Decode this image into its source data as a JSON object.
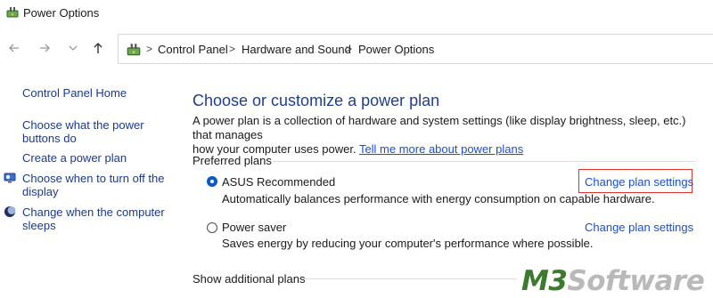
{
  "window": {
    "title": "Power Options"
  },
  "navigation": {
    "back_icon": "arrow-left-icon",
    "forward_icon": "arrow-right-icon",
    "recent_icon": "chevron-down-icon",
    "up_icon": "arrow-up-icon"
  },
  "breadcrumb": {
    "separator": ">",
    "items": [
      "Control Panel",
      "Hardware and Sound",
      "Power Options"
    ]
  },
  "sidebar": {
    "home": "Control Panel Home",
    "links": [
      {
        "label": "Choose what the power buttons do",
        "lines": [
          "Choose what the power",
          "buttons do"
        ],
        "icon": ""
      },
      {
        "label": "Create a power plan",
        "lines": [
          "Create a power plan"
        ],
        "icon": ""
      },
      {
        "label": "Choose when to turn off the display",
        "lines": [
          "Choose when to turn off the",
          "display"
        ],
        "icon": "monitor-icon"
      },
      {
        "label": "Change when the computer sleeps",
        "lines": [
          "Change when the computer",
          "sleeps"
        ],
        "icon": "moon-icon"
      }
    ]
  },
  "main": {
    "heading": "Choose or customize a power plan",
    "description": "A power plan is a collection of hardware and system settings (like display brightness, sleep, etc.) that manages how your computer uses power.",
    "description_line1": "A power plan is a collection of hardware and system settings (like display brightness, sleep, etc.) that manages",
    "description_line2": "how your computer uses power.",
    "learn_more_link": "Tell me more about power plans",
    "preferred_plans_label": "Preferred plans",
    "plans": [
      {
        "name": "ASUS Recommended",
        "selected": true,
        "description": "Automatically balances performance with energy consumption on capable hardware.",
        "change_link": "Change plan settings",
        "highlighted": true
      },
      {
        "name": "Power saver",
        "selected": false,
        "description": "Saves energy by reducing your computer's performance where possible.",
        "change_link": "Change plan settings",
        "highlighted": false
      }
    ],
    "show_additional": "Show additional plans"
  },
  "watermark": {
    "prefix": "M3",
    "suffix": "Software"
  },
  "colors": {
    "heading": "#1e3f8f",
    "link": "#1a4fd0",
    "sidebar_link": "#1a3a8a",
    "radio_selected": "#0a5bc4",
    "highlight": "#e0312b"
  }
}
